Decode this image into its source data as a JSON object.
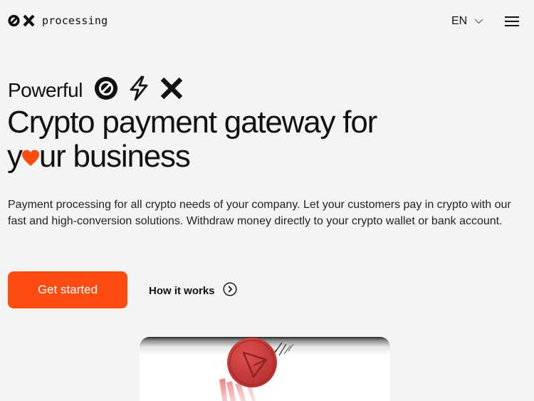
{
  "header": {
    "logo_text": "processing",
    "logo_icon": "0x-logo-icon",
    "language": "EN",
    "language_icon": "chevron-down-icon",
    "menu_icon": "hamburger-menu-icon"
  },
  "hero": {
    "powerful": "Powerful",
    "powerful_icons": [
      "no-entry-icon",
      "lightning-bolt-icon",
      "cross-x-icon"
    ],
    "headline_line1": "Crypto payment gateway for",
    "headline_y": "y",
    "headline_rest": "ur business",
    "heart_icon": "heart-icon",
    "description": "Payment processing for all crypto needs of your company. Let your customers pay in crypto with our fast and high-conversion solutions. Withdraw money directly to your crypto wallet or bank account.",
    "cta_label": "Get started",
    "how_label": "How it works",
    "how_icon": "arrow-right-circle-icon"
  },
  "visual": {
    "coin_icon": "tron-coin-icon"
  },
  "colors": {
    "accent": "#ff4d12",
    "heart": "#ff4d12",
    "coin": "#c93a3a",
    "background": "#f4f4f4",
    "text": "#111111"
  }
}
